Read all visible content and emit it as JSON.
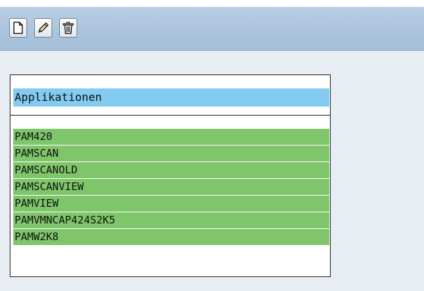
{
  "toolbar": {
    "buttons": [
      {
        "icon": "new-document-icon"
      },
      {
        "icon": "pencil-icon"
      },
      {
        "icon": "trash-icon"
      }
    ]
  },
  "panel": {
    "header": "Applikationen",
    "items": [
      "PAM420",
      "PAMSCAN",
      "PAMSCANOLD",
      "PAMSCANVIEW",
      "PAMVIEW",
      "PAMVMNCAP424S2K5",
      "PAMW2K8"
    ]
  },
  "colors": {
    "background": "#e8edf4",
    "toolbar": "#a3bed9",
    "header_highlight": "#84cbf2",
    "item_green": "#7fc66a"
  }
}
